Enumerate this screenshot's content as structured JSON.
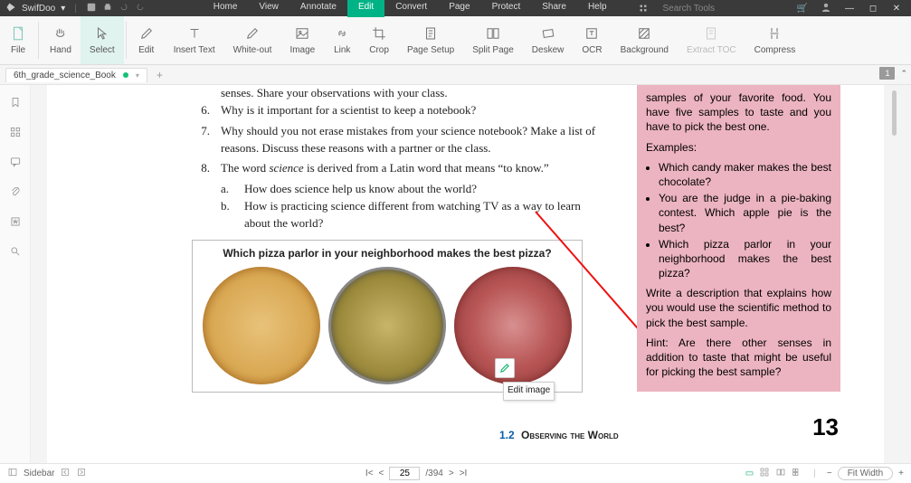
{
  "app": {
    "name": "SwifDoo"
  },
  "titlebar_menus": [
    "Home",
    "View",
    "Annotate",
    "Edit",
    "Convert",
    "Page",
    "Protect",
    "Share",
    "Help"
  ],
  "titlebar_active": "Edit",
  "search_placeholder": "Search Tools",
  "ribbon": {
    "file": "File",
    "hand": "Hand",
    "select": "Select",
    "edit": "Edit",
    "insert_text": "Insert Text",
    "white_out": "White-out",
    "image": "Image",
    "link": "Link",
    "crop": "Crop",
    "page_setup": "Page Setup",
    "split_page": "Split Page",
    "deskew": "Deskew",
    "ocr": "OCR",
    "background": "Background",
    "extract_toc": "Extract TOC",
    "compress": "Compress"
  },
  "tab": {
    "name": "6th_grade_science_Book",
    "page_indicator": "1"
  },
  "doc": {
    "line0": "senses. Share your observations with your class.",
    "q6": "Why is it important for a scientist to keep a notebook?",
    "q7": "Why should you not erase mistakes from your science notebook? Make a list of reasons. Discuss these reasons with a partner or the class.",
    "q8a": "The word ",
    "q8b": "science",
    "q8c": " is derived from a Latin word that means “to know.”",
    "sa": "How does science help us know about the world?",
    "sb": "How is practicing science different from watching TV as a way to learn about the world?",
    "caption": "Which pizza parlor in your neighborhood makes the best pizza?"
  },
  "sidebox": {
    "p1": "samples of your favorite food. You have five samples to taste and you have to pick the best one.",
    "ex": "Examples:",
    "li1": "Which candy maker makes the best chocolate?",
    "li2": "You are the judge in a pie-baking contest. Which apple pie is the best?",
    "li3": "Which pizza parlor in your neighborhood makes the best pizza?",
    "p2": "Write a description that explains how you would use the scientific method to pick the best sample.",
    "p3": "Hint: Are there other senses in addition to taste that might be useful for picking the best sample?"
  },
  "section": {
    "num": "1.2",
    "title": "Observing the World",
    "pagenum": "13"
  },
  "tooltip": "Edit image",
  "status": {
    "sidebar": "Sidebar",
    "current": "25",
    "total": "/394",
    "zoom": "Fit Width"
  }
}
